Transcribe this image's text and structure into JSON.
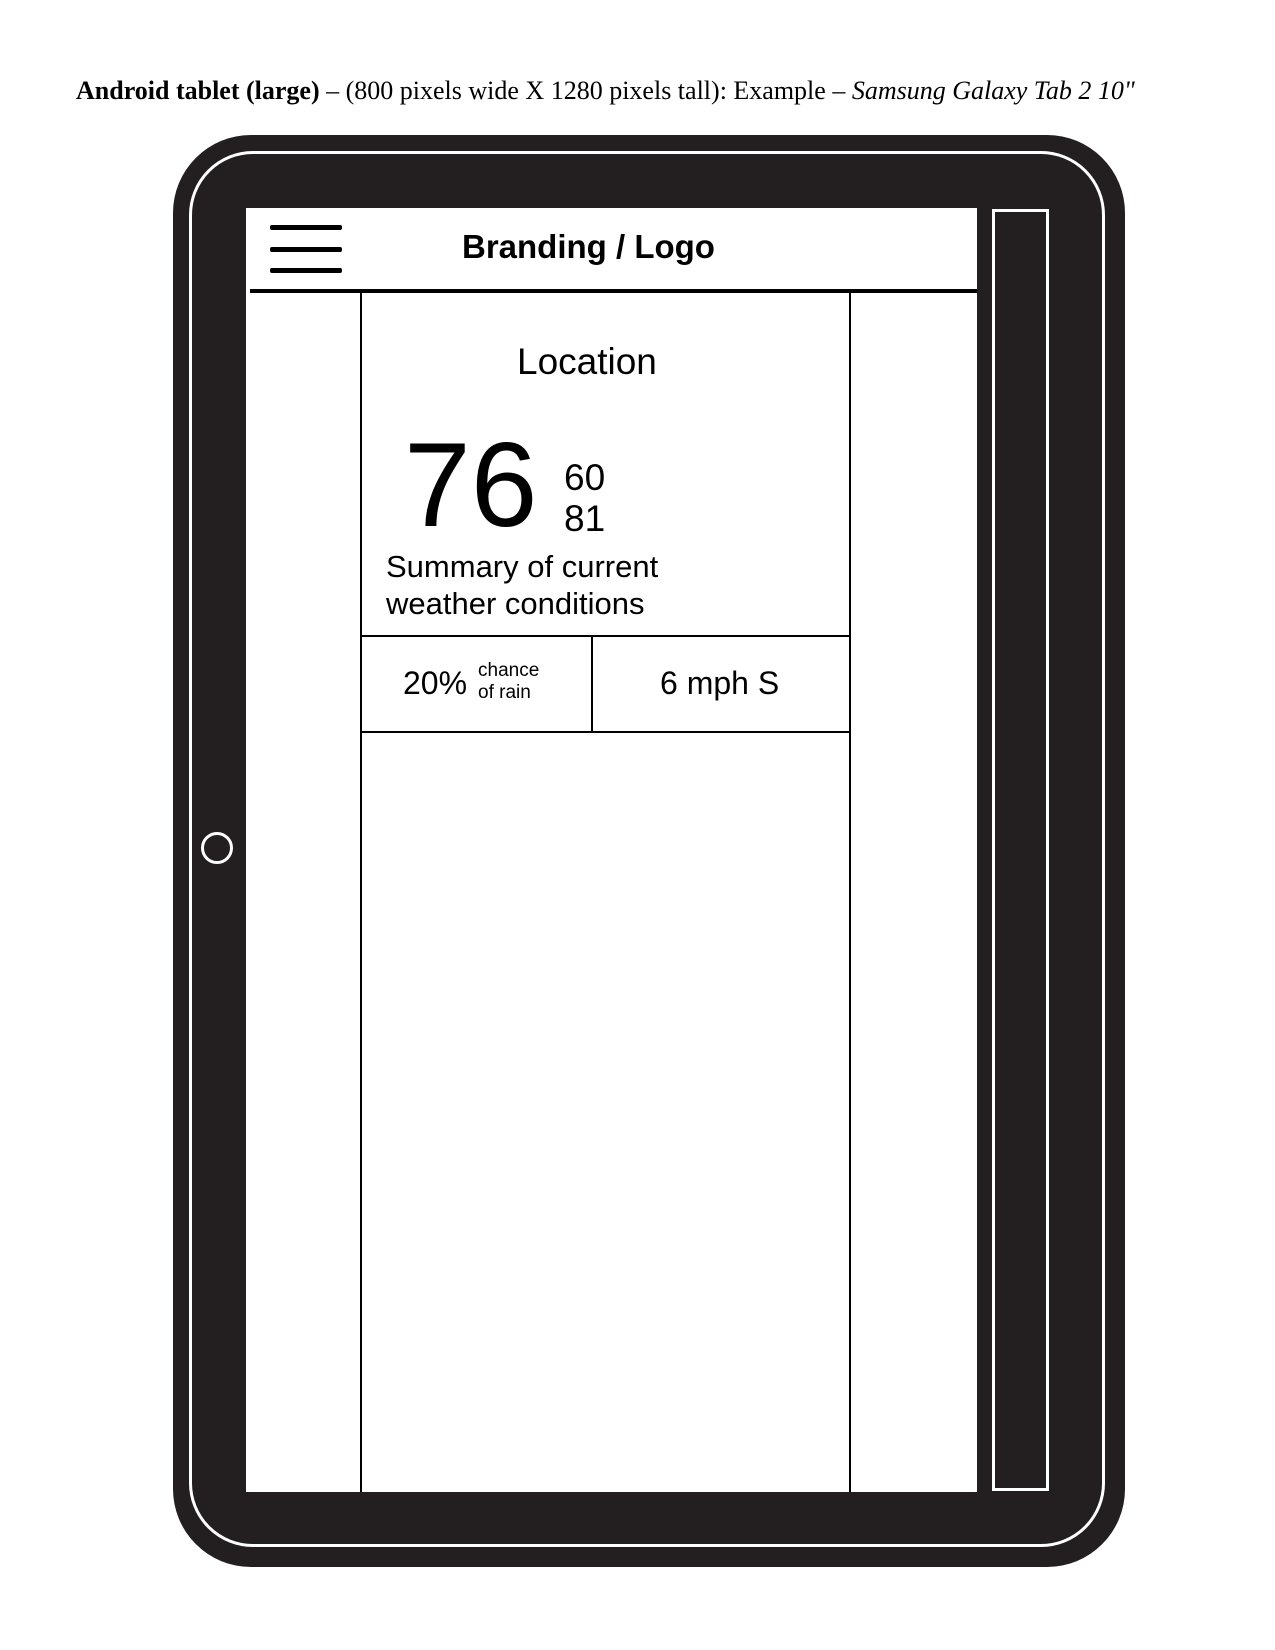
{
  "caption": {
    "device": "Android tablet (large)",
    "dash1": " – ",
    "dimensions": "(800 pixels wide X 1280 pixels tall)",
    "example_label": ": Example – ",
    "example_device": "Samsung Galaxy Tab 2 10\""
  },
  "header": {
    "brand": "Branding / Logo",
    "menu_icon": "hamburger-menu-icon"
  },
  "weather": {
    "location": "Location",
    "current_temp": "76",
    "low_temp": "60",
    "high_temp": "81",
    "summary_line1": "Summary of current",
    "summary_line2": "weather conditions",
    "rain_percent": "20%",
    "rain_label_line1": "chance",
    "rain_label_line2": "of rain",
    "wind": "6 mph S"
  },
  "colors": {
    "device_body": "#231f20",
    "screen": "#ffffff",
    "ink": "#000000"
  }
}
